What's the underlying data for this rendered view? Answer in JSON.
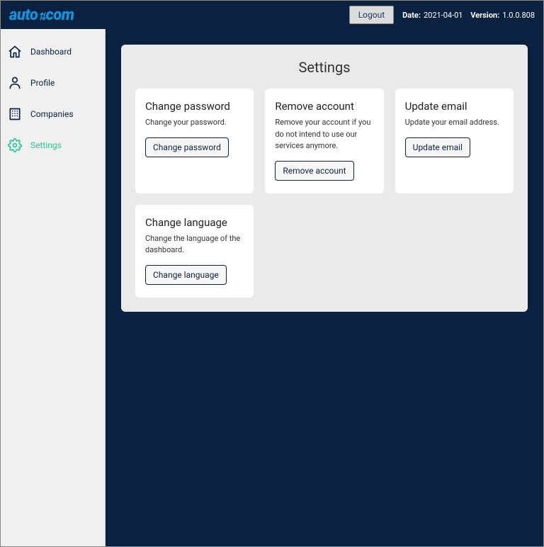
{
  "header": {
    "logo_text": "auto com",
    "logout_label": "Logout",
    "date_label": "Date:",
    "date_value": "2021-04-01",
    "version_label": "Version:",
    "version_value": "1.0.0.808"
  },
  "sidebar": {
    "items": [
      {
        "label": "Dashboard"
      },
      {
        "label": "Profile"
      },
      {
        "label": "Companies"
      },
      {
        "label": "Settings"
      }
    ]
  },
  "main": {
    "title": "Settings",
    "cards": [
      {
        "title": "Change password",
        "desc": "Change your password.",
        "button": "Change password"
      },
      {
        "title": "Remove account",
        "desc": "Remove your account if you do not intend to use our services anymore.",
        "button": "Remove account"
      },
      {
        "title": "Update email",
        "desc": "Update your email address.",
        "button": "Update email"
      },
      {
        "title": "Change language",
        "desc": "Change the language of the dashboard.",
        "button": "Change language"
      }
    ]
  }
}
